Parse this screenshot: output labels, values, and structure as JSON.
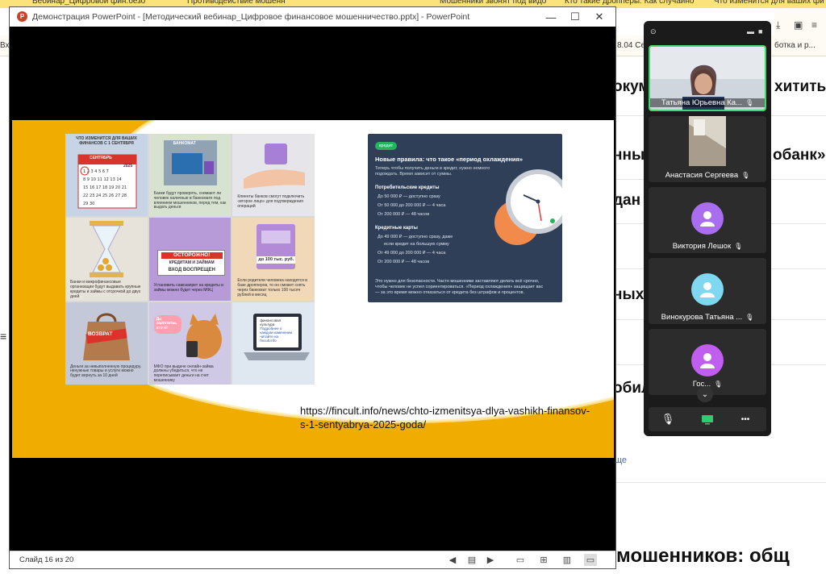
{
  "browser": {
    "tabs": [
      "Вебинар_Цифровой фин.безо",
      "Противодействие мошенн",
      "Мошенники звонят под видо",
      "Кто такие дропперы: Как случайно",
      "Что изменится для ваших фи"
    ],
    "bookmarks": [
      "Вх",
      "8.04 Сер",
      "ботка и р..."
    ],
    "page_fragments": [
      "окум",
      "хитить",
      "нны",
      "обанк»",
      "дан",
      "ных",
      "обил",
      "мошенников: общ"
    ],
    "page_small": "ще"
  },
  "ppt": {
    "title": "Демонстрация PowerPoint - [Методический вебинар_Цифровое финансовое мошенничество.pptx] - PowerPoint",
    "logo": "P",
    "minimize": "—",
    "maximize": "☐",
    "close": "✕",
    "status": "Слайд 16 из 20",
    "slide": {
      "link": "https://fincult.info/news/chto-izmenitsya-dlya-vashikh-finansov-s-1-sentyabrya-2025-goda/",
      "mosaic": {
        "t1_title": "ЧТО ИЗМЕНИТСЯ ДЛЯ ВАШИХ ФИНАНСОВ С 1 СЕНТЯБРЯ",
        "t1_month": "СЕНТЯБРЬ",
        "t1_year": "2025",
        "t2_label": "БАНКОМАТ",
        "t2_text": "Банки будут проверять, снимают ли человек наличные в банкомате под влиянием мошенников, перед тем, как выдать деньги",
        "t3_text": "Клиенты банков смогут подключить «второе лицо» для подтверждения операций",
        "t4_text": "Банки и микрофинансовые организации будут выдавать крупные кредиты и займы с отсрочкой до двух дней",
        "t5_sign1": "ОСТОРОЖНО!",
        "t5_sign2": "КРЕДИТАМ И ЗАЙМАМ",
        "t5_sign3": "ВХОД ВОСПРЕЩЕН",
        "t5_text": "Установить самозапрет на кредиты и займы можно будет через МФЦ",
        "t6_label": "до 100 тыс. руб.",
        "t6_text": "Если родители человека находятся в базе дропперов, то он сможет снять через банкомат только 100 тысяч рублей в месяц",
        "t7_label": "ВОЗВРАТ",
        "t7_text": "Деньги за невыполненную процедуру, ненужные товары и услуги можно будет вернуть за 10 дней",
        "t8_bubble": "До зарплаты, это я!",
        "t8_text": "МФО при выдаче онлайн-займа должны убедиться, что не переписывает деньги на счет мошеннику",
        "t9_logo": "финансовая культура",
        "t9_screen": "Подробнее о каждом изменении читайте на fincult.info"
      },
      "credit": {
        "badge": "кредит",
        "title": "Новые правила: что такое «период охлаждения»",
        "sub": "Теперь чтобы получить деньги в кредит, нужно немного подождать. Время зависит от суммы.",
        "consumer_head": "Потребительские кредиты",
        "consumer_items": [
          "До 50 000 ₽ — доступно сразу",
          "От 50 000 до 200 000 ₽ — 4 часа",
          "От 200 000 ₽ — 48 часов"
        ],
        "card_head": "Кредитные карты",
        "card_items": [
          "До 49 000 ₽ — доступно сразу, даже",
          "если кредит на большую сумму",
          "От 49 000 до 200 000 ₽ — 4 часа",
          "От 200 000 ₽ — 48 часов"
        ],
        "footer": "Это нужно для безопасности. Часто мошенники заставляют делать всё срочно, чтобы человек не успел сориентироваться. «Период охлаждения» защищает вас — за это время можно отказаться от кредита без штрафов и процентов."
      }
    }
  },
  "call": {
    "participants": [
      {
        "name": "Татьяна Юрьевна Ка..."
      },
      {
        "name": "Анастасия Сергеева"
      },
      {
        "name": "Виктория Лешок"
      },
      {
        "name": "Винокурова Татьяна ..."
      },
      {
        "name": "Гос..."
      }
    ],
    "mic_icon": "🎙",
    "more": "•••"
  },
  "colors": {
    "slide_accent": "#f0ad00",
    "credit_bg": "#2e3f57",
    "call_bg": "#1b1b1b",
    "active_border": "#3ddc6a",
    "avatar_purple": "#a96ef0",
    "avatar_cyan": "#7fd8f0",
    "avatar_magenta": "#c05ef0"
  }
}
